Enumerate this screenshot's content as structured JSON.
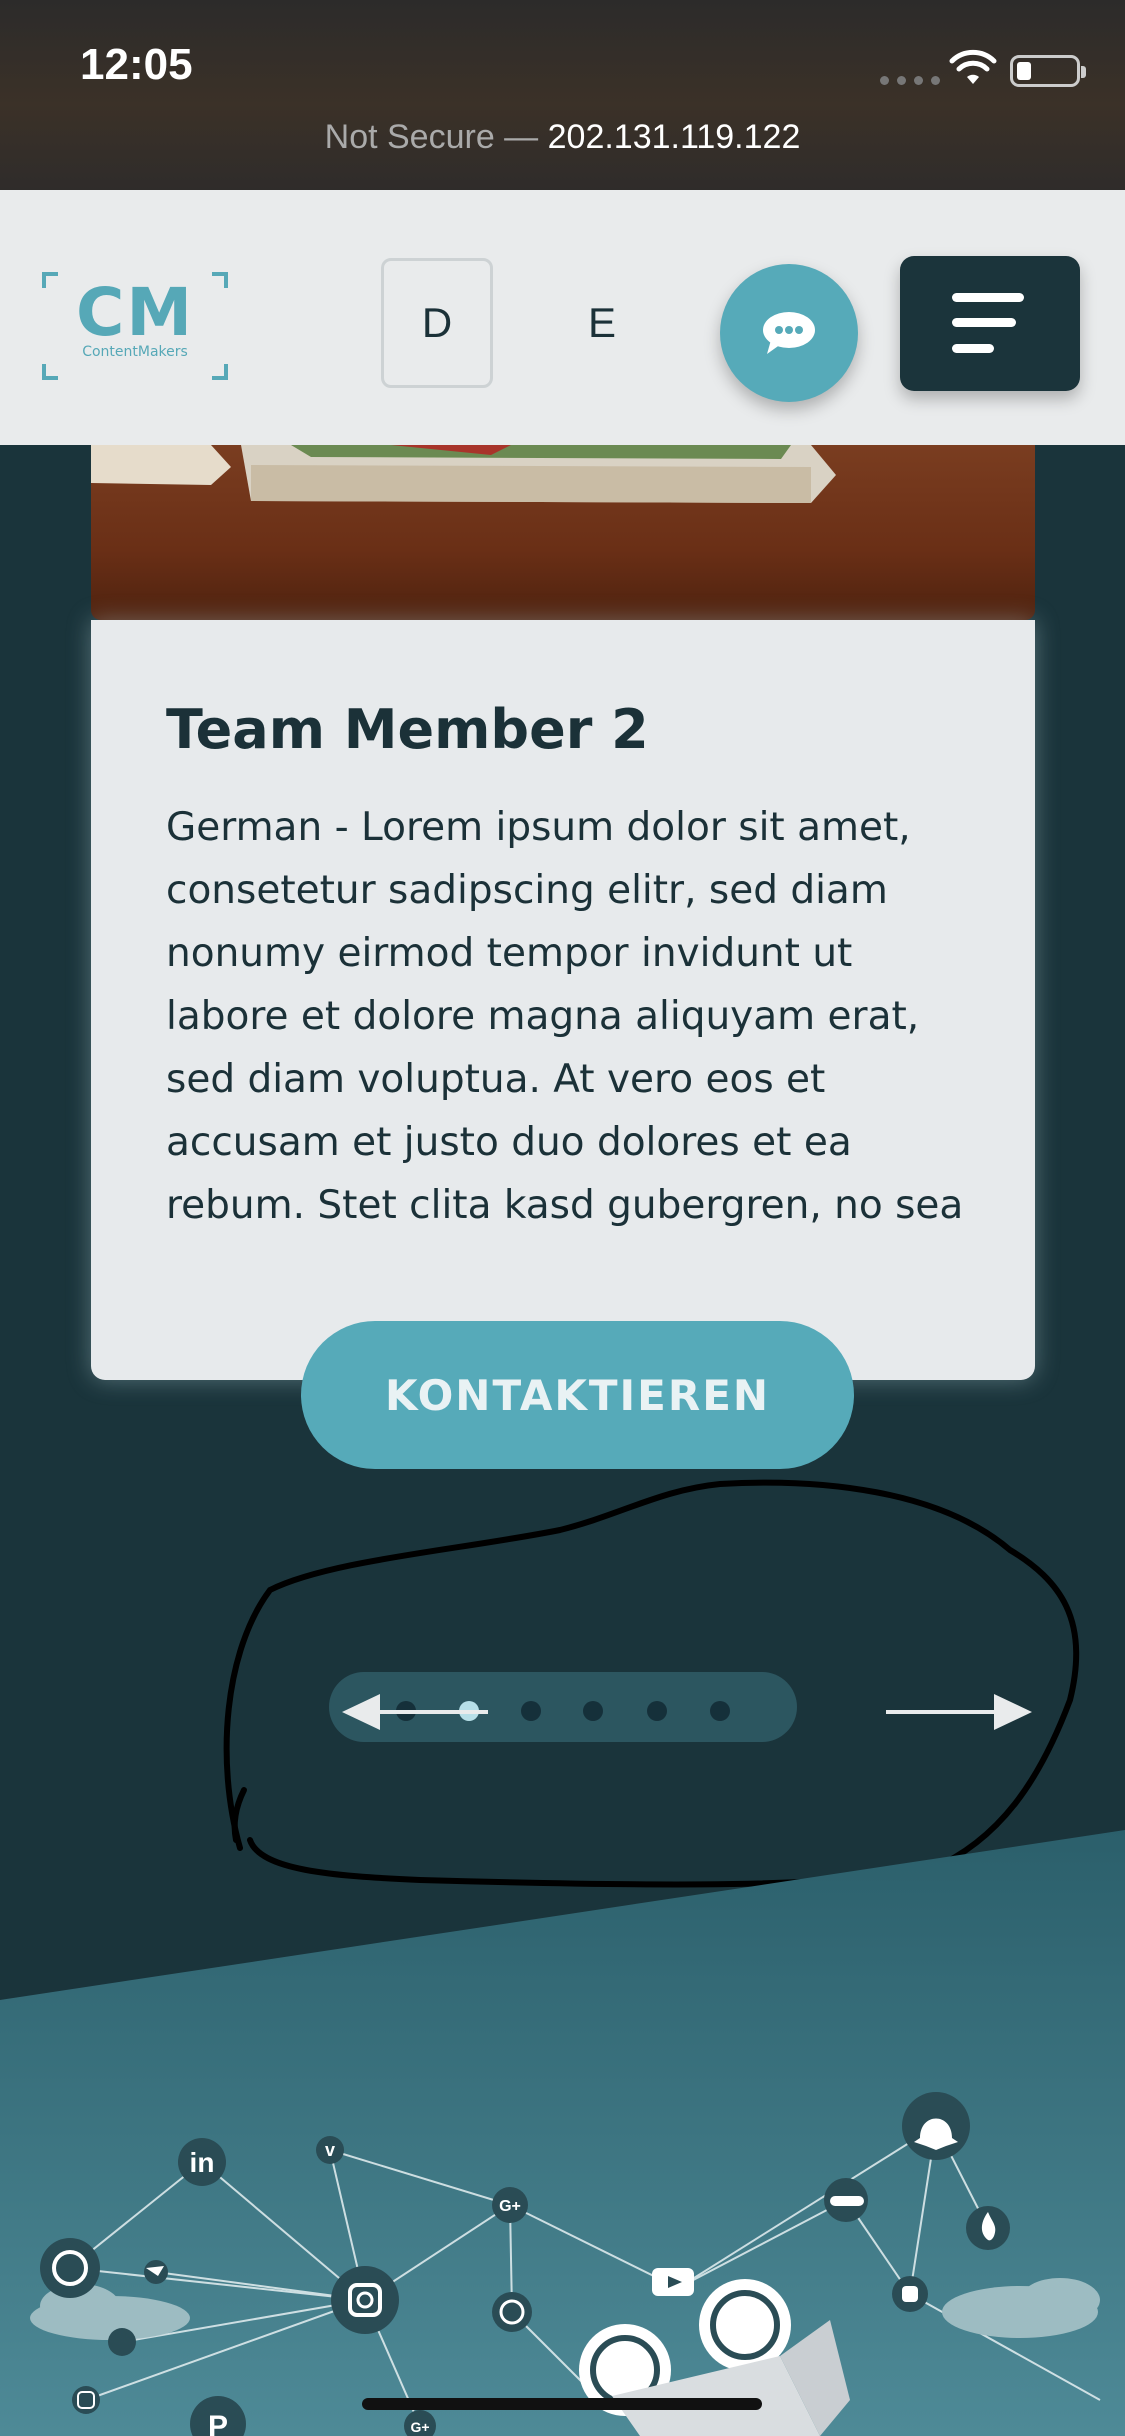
{
  "status_bar": {
    "time": "12:05"
  },
  "url_bar": {
    "security": "Not Secure —",
    "host": "202.131.119.122"
  },
  "header": {
    "logo_mark": "CM",
    "logo_text": "ContentMakers",
    "lang_d": "D",
    "lang_e": "E",
    "chat_icon": "chat-bubble-icon",
    "menu_icon": "hamburger-menu-icon"
  },
  "card": {
    "title": "Team Member 2",
    "text": "German - Lorem ipsum dolor sit amet, consetetur sadipscing elitr, sed diam nonumy eirmod tempor invidunt ut labore et dolore magna aliquyam erat, sed diam voluptua. At vero eos et accusam et justo duo dolores et ea rebum. Stet clita kasd gubergren, no sea"
  },
  "cta": {
    "label": "KONTAKTIEREN"
  },
  "slider": {
    "count": 6,
    "active_index": 1
  },
  "colors": {
    "accent": "#56aab9",
    "dark": "#1b343b",
    "card": "#e7eaec"
  }
}
